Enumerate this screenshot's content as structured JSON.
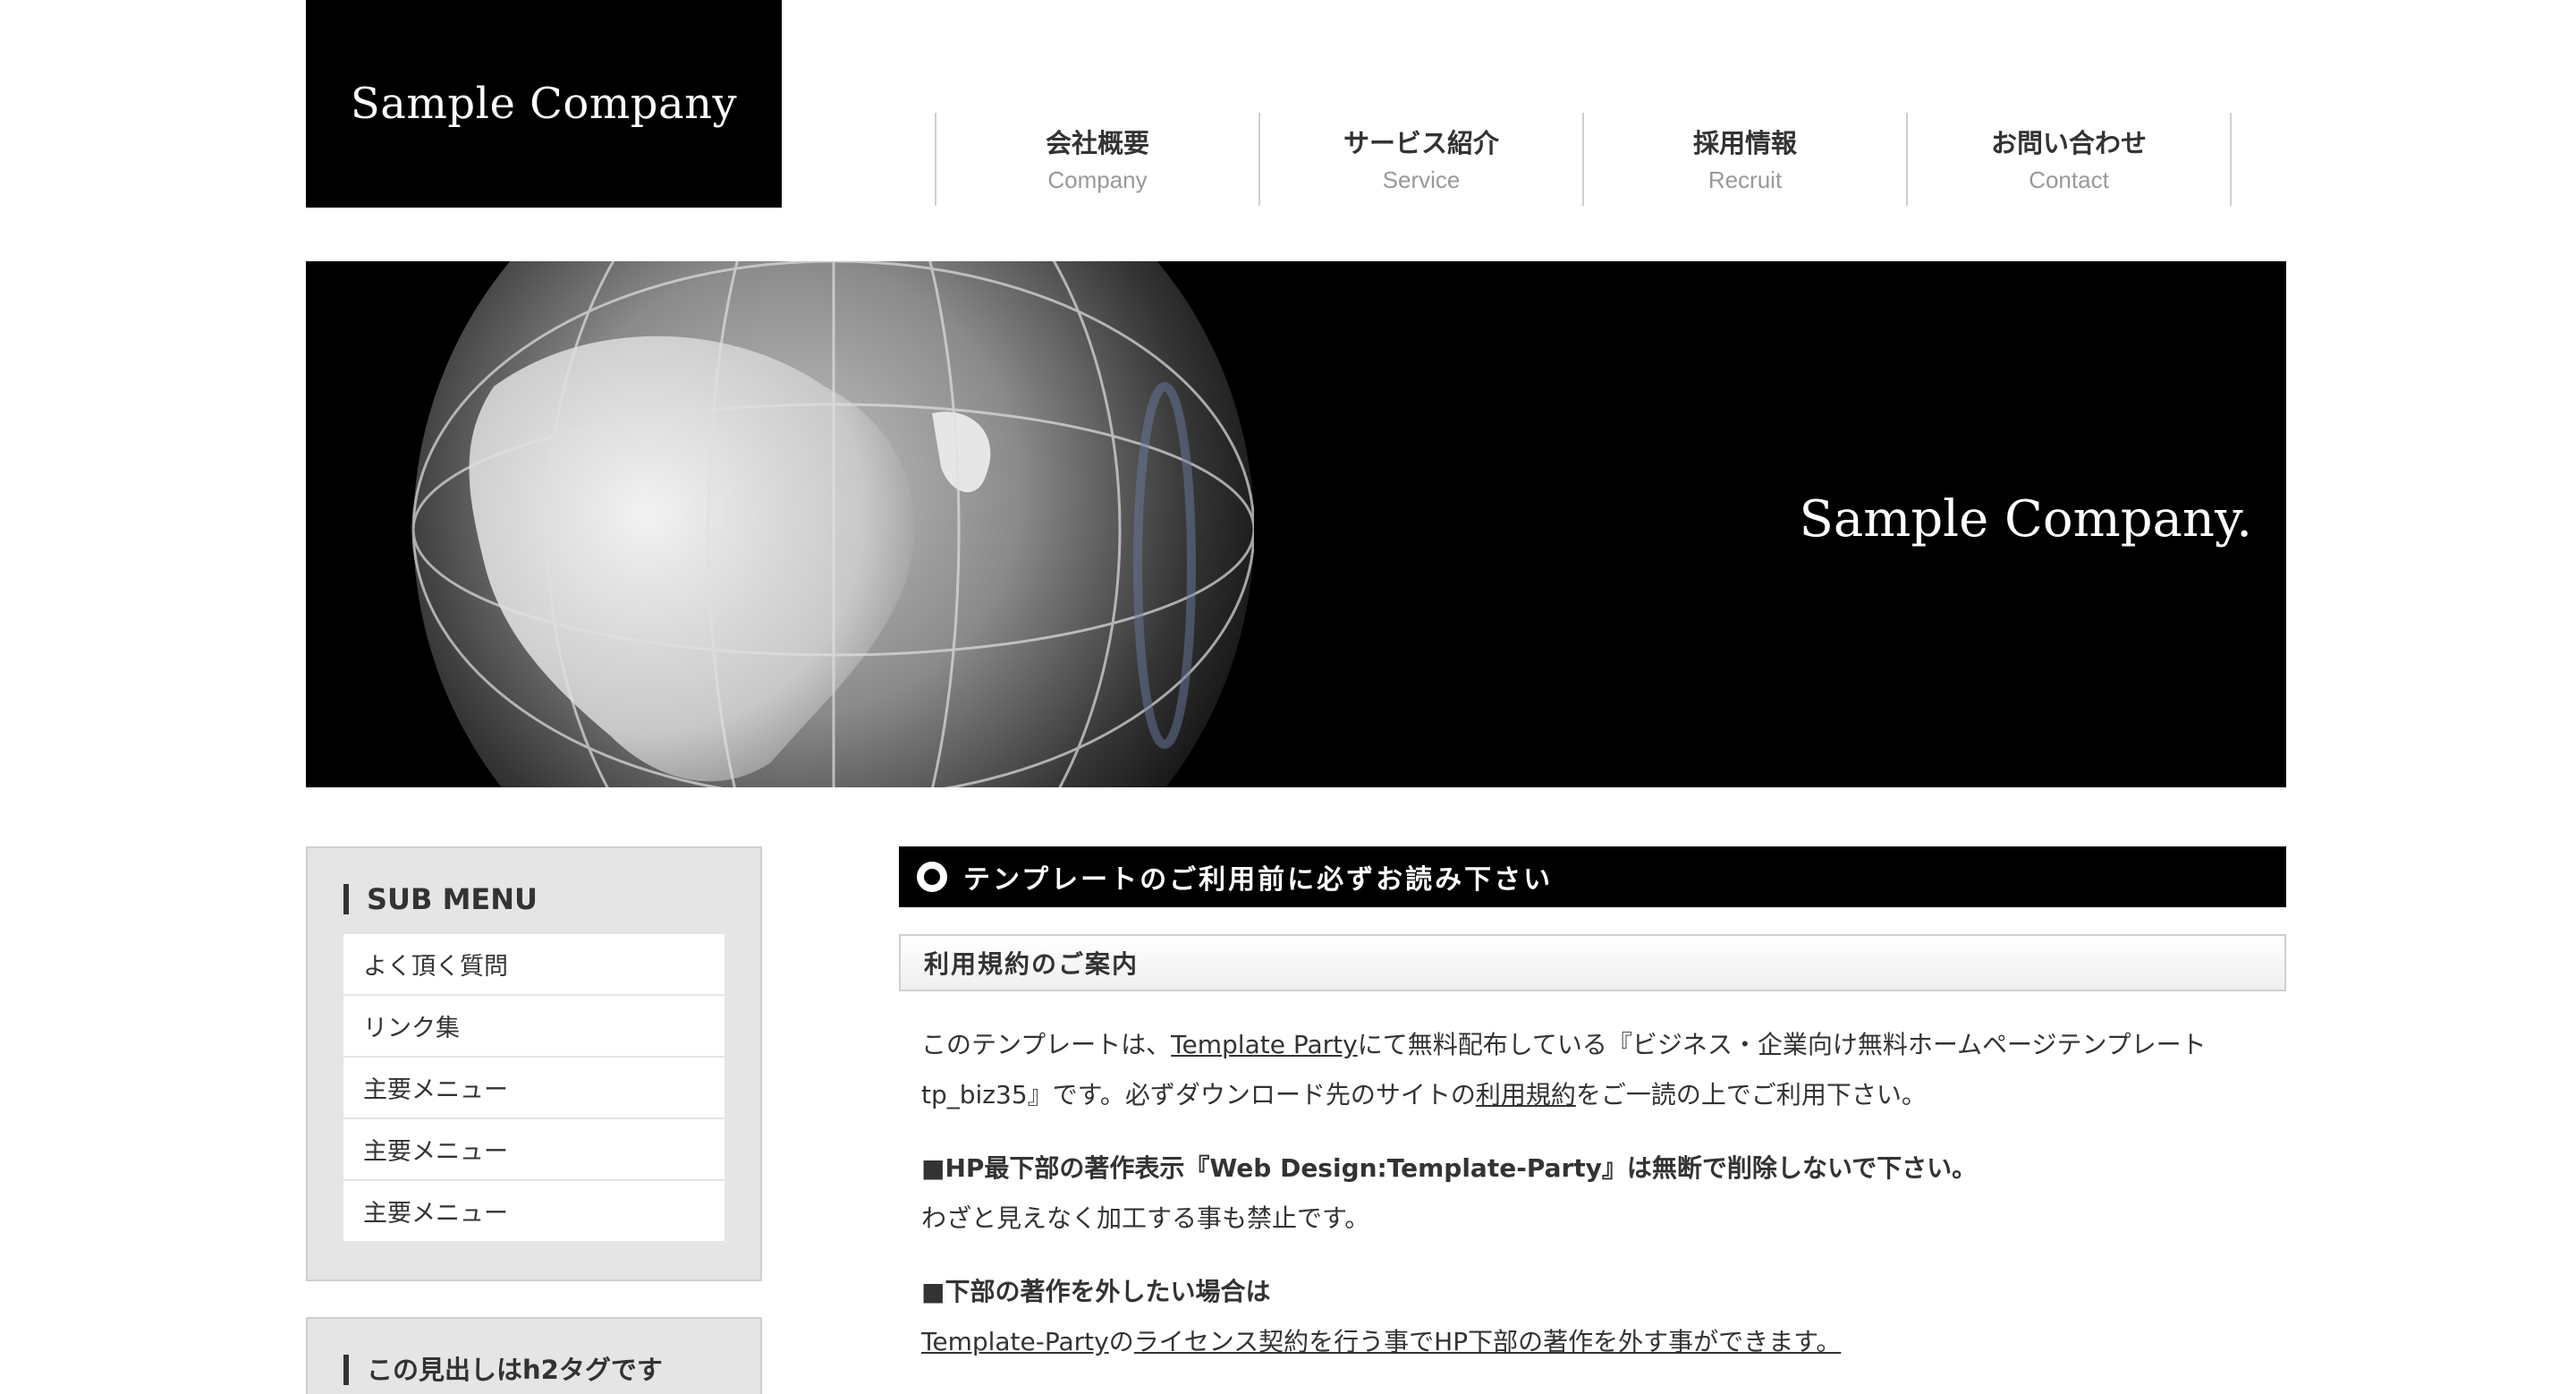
{
  "header": {
    "logo": "Sample Company",
    "nav": [
      {
        "jp": "会社概要",
        "en": "Company"
      },
      {
        "jp": "サービス紹介",
        "en": "Service"
      },
      {
        "jp": "採用情報",
        "en": "Recruit"
      },
      {
        "jp": "お問い合わせ",
        "en": "Contact"
      }
    ]
  },
  "hero": {
    "tagline": "Sample Company."
  },
  "sidebar": {
    "menu_heading": "SUB MENU",
    "items": [
      "よく頂く質問",
      "リンク集",
      "主要メニュー",
      "主要メニュー",
      "主要メニュー"
    ],
    "h2_heading": "この見出しはh2タグです"
  },
  "main": {
    "title": "テンプレートのご利用前に必ずお読み下さい",
    "subtitle": "利用規約のご案内",
    "p1_pre": "このテンプレートは、",
    "p1_link": "Template Party",
    "p1_mid": "にて無料配布している『ビジネス・企業向け無料ホームページテンプレート tp_biz35』です。必ずダウンロード先のサイトの",
    "p1_link2": "利用規約",
    "p1_post": "をご一読の上でご利用下さい。",
    "p2_bold": "■HP最下部の著作表示『Web Design:Template-Party』は無断で削除しないで下さい。",
    "p2_text": "わざと見えなく加工する事も禁止です。",
    "p3_bold": "■下部の著作を外したい場合は",
    "p3_link": "Template-Party",
    "p3_mid": "の",
    "p3_link2": "ライセンス契約を行う事でHP下部の著作を外す事ができます。"
  }
}
